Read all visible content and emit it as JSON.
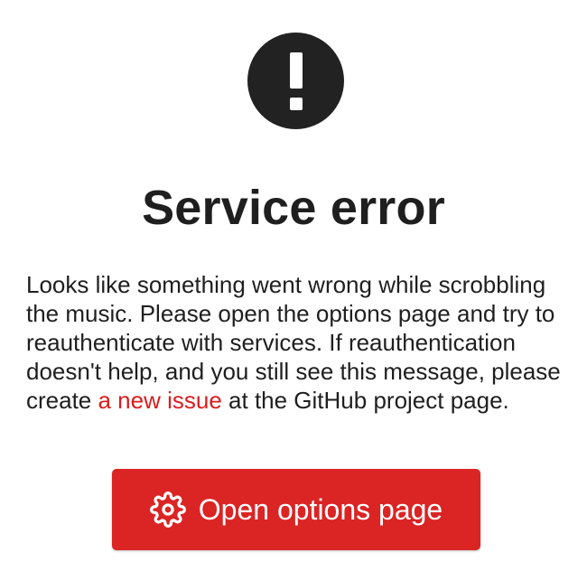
{
  "error": {
    "icon": "exclamation-icon",
    "title": "Service error",
    "message_before_link": "Looks like something went wrong while scrobbling the music. Please open the options page and try to reauthenticate with services. If reauthentication doesn't help, and you still see this message, please create ",
    "link_text": "a new issue",
    "message_after_link": " at the GitHub project page."
  },
  "button": {
    "icon": "gear-icon",
    "label": "Open options page"
  },
  "colors": {
    "icon_background": "#222222",
    "accent": "#db2424",
    "link": "#d81e1e",
    "text": "#1f1f1f"
  }
}
